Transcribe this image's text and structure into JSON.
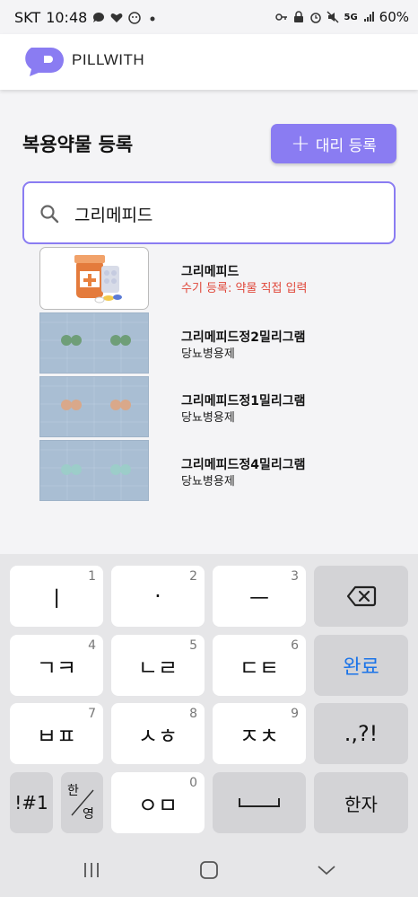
{
  "status": {
    "carrier": "SKT",
    "time": "10:48",
    "battery": "60%",
    "network": "5G"
  },
  "header": {
    "brand": "PILLWITH",
    "brand_color": "#8a7cf2"
  },
  "page": {
    "title": "복용약물 등록",
    "proxy_button": "대리 등록",
    "proxy_plus": "+"
  },
  "search": {
    "value": "그리메피드",
    "icon": "search-icon"
  },
  "results": [
    {
      "title": "그리메피드",
      "subtitle": "수기 등록: 약물 직접 입력",
      "kind": "manual"
    },
    {
      "title": "그리메피드정2밀리그램",
      "subtitle": "당뇨병용제",
      "kind": "photo",
      "pill_color": "#6f9e78"
    },
    {
      "title": "그리메피드정1밀리그램",
      "subtitle": "당뇨병용제",
      "kind": "photo",
      "pill_color": "#d9a88a"
    },
    {
      "title": "그리메피드정4밀리그램",
      "subtitle": "당뇨병용제",
      "kind": "photo",
      "pill_color": "#9ccdc9"
    }
  ],
  "keyboard": {
    "rows": [
      [
        {
          "label": "ㅣ",
          "num": "1"
        },
        {
          "label": "·",
          "num": "2"
        },
        {
          "label": "ㅡ",
          "num": "3"
        },
        {
          "label": "",
          "icon": "backspace-icon"
        }
      ],
      [
        {
          "label": "ㄱㅋ",
          "num": "4"
        },
        {
          "label": "ㄴㄹ",
          "num": "5"
        },
        {
          "label": "ㄷㅌ",
          "num": "6"
        },
        {
          "label": "완료"
        }
      ],
      [
        {
          "label": "ㅂㅍ",
          "num": "7"
        },
        {
          "label": "ㅅㅎ",
          "num": "8"
        },
        {
          "label": "ㅈㅊ",
          "num": "9"
        },
        {
          "label": ".,?!"
        }
      ],
      [
        {
          "label": "!#1"
        },
        {
          "label": "한/영"
        },
        {
          "label": "ㅇㅁ",
          "num": "0"
        },
        {
          "label": "",
          "icon": "space-icon"
        },
        {
          "label": "한자"
        }
      ]
    ],
    "hanyeong_top": "한",
    "hanyeong_bottom": "영"
  },
  "navbar": {
    "items": [
      "recent-apps-icon",
      "home-icon",
      "back-icon"
    ]
  }
}
